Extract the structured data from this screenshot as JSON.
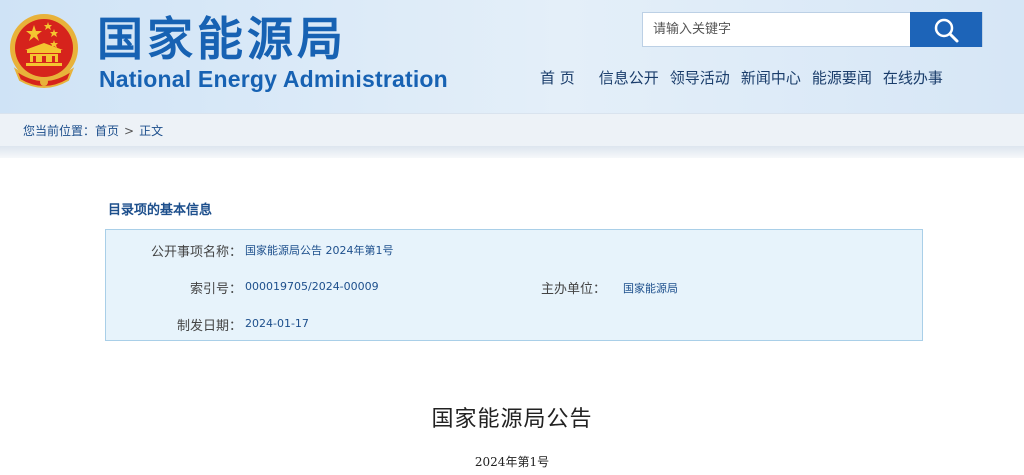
{
  "header": {
    "logo_cn": "国家能源局",
    "logo_en": "National Energy Administration",
    "search": {
      "placeholder": "请输入关键字"
    },
    "nav": [
      "首 页",
      "信息公开",
      "领导活动",
      "新闻中心",
      "能源要闻",
      "在线办事"
    ]
  },
  "breadcrumb": {
    "prefix": "您当前位置：",
    "home": "首页",
    "separator": ">",
    "current": "正文"
  },
  "info": {
    "section_title": "目录项的基本信息",
    "name_label": "公开事项名称：",
    "name_value": "国家能源局公告 2024年第1号",
    "index_label": "索引号：",
    "index_value": "000019705/2024-00009",
    "unit_label": "主办单位：",
    "unit_value": "国家能源局",
    "date_label": "制发日期：",
    "date_value": "2024-01-17"
  },
  "document": {
    "title": "国家能源局公告",
    "number": "2024年第1号"
  },
  "colors": {
    "brand_blue": "#1762b3",
    "search_button": "#1d64b8",
    "info_bg": "#e7f3fb",
    "emblem_red": "#d6231c",
    "emblem_gold": "#f4c430"
  }
}
